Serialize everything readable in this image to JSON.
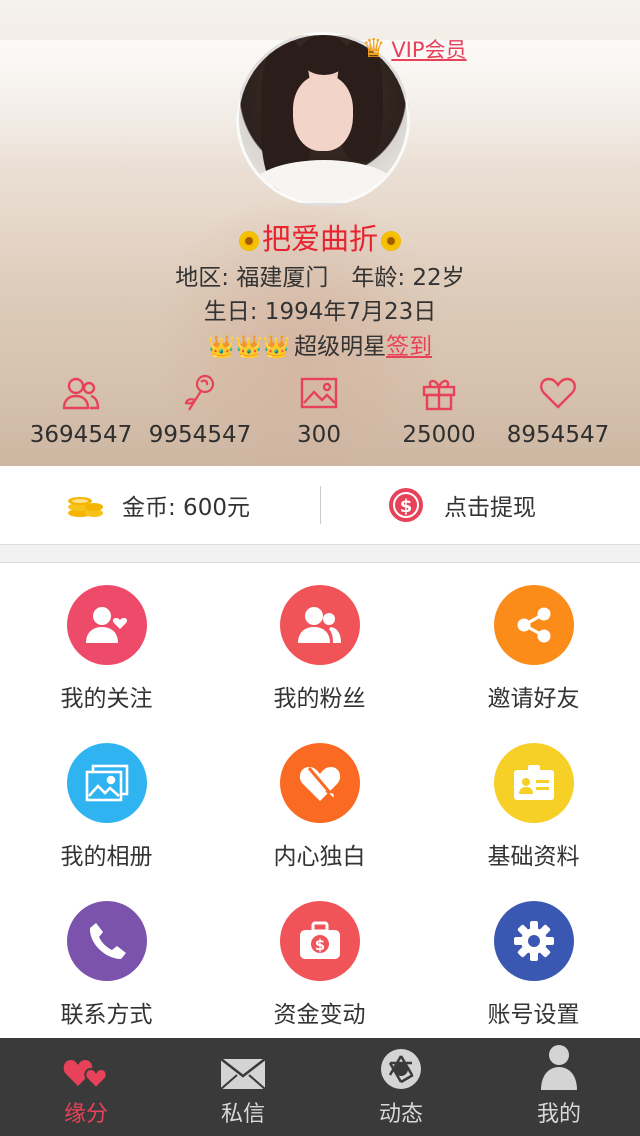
{
  "profile": {
    "vip_label": "VIP会员",
    "nickname": "把爱曲折",
    "region_line": "地区: 福建厦门　年龄: 22岁",
    "birthday_line": "生日: 1994年7月23日",
    "level_text": "超级明星",
    "sign_label": "签到",
    "crowns": "👑👑👑"
  },
  "stats": [
    {
      "icon": "users-icon",
      "value": "3694547"
    },
    {
      "icon": "rose-icon",
      "value": "9954547"
    },
    {
      "icon": "photo-icon",
      "value": "300"
    },
    {
      "icon": "gift-icon",
      "value": "25000"
    },
    {
      "icon": "heart-icon",
      "value": "8954547"
    }
  ],
  "wallet": {
    "coins_label": "金币: 600元",
    "withdraw_label": "点击提现"
  },
  "menu": [
    {
      "label": "我的关注",
      "color": "#ee4b6a",
      "icon": "follow-icon"
    },
    {
      "label": "我的粉丝",
      "color": "#f05459",
      "icon": "fans-icon"
    },
    {
      "label": "邀请好友",
      "color": "#fb8c1a",
      "icon": "share-icon"
    },
    {
      "label": "我的相册",
      "color": "#2fb3f1",
      "icon": "album-icon"
    },
    {
      "label": "内心独白",
      "color": "#fb6a22",
      "icon": "heart-pen-icon"
    },
    {
      "label": "基础资料",
      "color": "#f6cf27",
      "icon": "id-card-icon"
    },
    {
      "label": "联系方式",
      "color": "#7b53ac",
      "icon": "phone-icon"
    },
    {
      "label": "资金变动",
      "color": "#f05459",
      "icon": "money-bag-icon"
    },
    {
      "label": "账号设置",
      "color": "#3a58b2",
      "icon": "gear-icon"
    }
  ],
  "tabs": [
    {
      "label": "缘分",
      "icon": "hearts-icon",
      "active": true
    },
    {
      "label": "私信",
      "icon": "envelope-icon",
      "active": false
    },
    {
      "label": "动态",
      "icon": "aperture-icon",
      "active": false
    },
    {
      "label": "我的",
      "icon": "person-icon",
      "active": false
    }
  ],
  "colors": {
    "accent": "#e8415a",
    "tabbar_bg": "#3a3a3a",
    "coin": "#f4b400"
  }
}
